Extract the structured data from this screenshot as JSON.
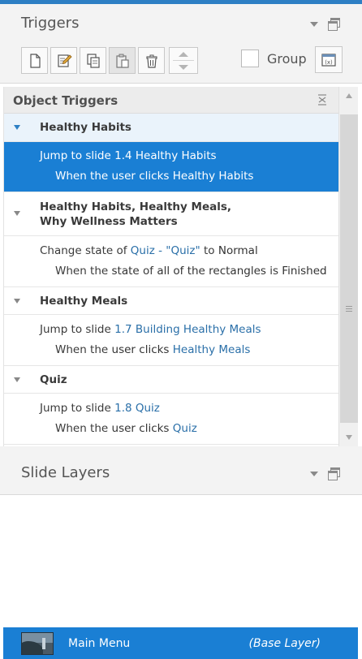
{
  "triggers_panel": {
    "title": "Triggers",
    "group_label": "Group"
  },
  "object_triggers": {
    "header": "Object Triggers",
    "groups": [
      {
        "name": "Healthy Habits",
        "triggers": [
          {
            "action": "Jump to slide",
            "target": "1.4 Healthy Habits",
            "cond_pre": "When the user clicks",
            "cond_target": "Healthy Habits"
          }
        ]
      },
      {
        "name_line1": "Healthy Habits, Healthy Meals,",
        "name_line2": "Why Wellness Matters",
        "triggers": [
          {
            "action": "Change state of",
            "target": "Quiz - \"Quiz\"",
            "to": "to",
            "state": "Normal",
            "cond_pre": "When the",
            "cond_mid": "state",
            "cond_mid2": "of",
            "cond_mid3": "all of the rectangles",
            "cond_mid4": "is",
            "cond_target": "Finished"
          }
        ]
      },
      {
        "name": "Healthy Meals",
        "triggers": [
          {
            "action": "Jump to slide",
            "target": "1.7 Building Healthy Meals",
            "cond_pre": "When the",
            "cond_user": "user",
            "cond_clicks": "clicks",
            "cond_target": "Healthy Meals"
          }
        ]
      },
      {
        "name": "Quiz",
        "triggers": [
          {
            "action": "Jump to slide",
            "target": "1.8 Quiz",
            "cond_pre": "When the",
            "cond_user": "user",
            "cond_clicks": "clicks",
            "cond_target": "Quiz"
          }
        ]
      }
    ]
  },
  "layers_panel": {
    "title": "Slide Layers",
    "base_layer": {
      "name": "Main Menu",
      "tag": "(Base Layer)"
    }
  },
  "colors": {
    "accent": "#1a7fd4",
    "link": "#2a6fa8",
    "panel_bg": "#f3f3f3"
  }
}
